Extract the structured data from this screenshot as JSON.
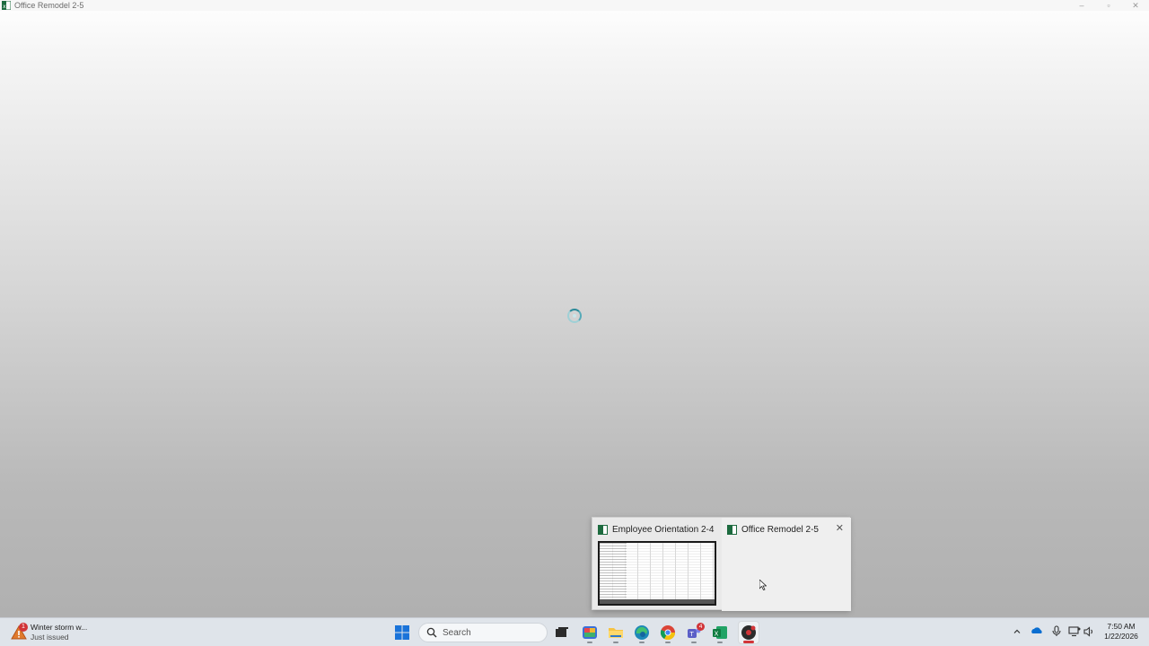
{
  "window": {
    "title": "Office Remodel 2-5",
    "icon": "excel-icon",
    "controls": {
      "minimize": "–",
      "maximize": "▫",
      "close": "✕"
    }
  },
  "loading": {
    "icon": "loading-spinner-icon"
  },
  "taskbar_preview": {
    "items": [
      {
        "title": "Employee Orientation 2-4",
        "icon": "excel-icon",
        "has_thumbnail": true
      },
      {
        "title": "Office Remodel 2-5",
        "icon": "excel-icon",
        "has_thumbnail": false,
        "close": "✕"
      }
    ]
  },
  "taskbar": {
    "weather": {
      "title": "Winter storm w...",
      "subtitle": "Just issued",
      "badge": "1",
      "icon": "weather-alert-icon"
    },
    "search_placeholder": "Search",
    "apps": [
      {
        "name": "start",
        "icon": "windows-start-icon"
      },
      {
        "name": "task-view",
        "icon": "task-view-icon"
      },
      {
        "name": "copilot",
        "icon": "copilot-icon"
      },
      {
        "name": "file-explorer",
        "icon": "folder-icon"
      },
      {
        "name": "edge",
        "icon": "edge-icon"
      },
      {
        "name": "chrome",
        "icon": "chrome-icon"
      },
      {
        "name": "teams",
        "icon": "teams-icon",
        "badge": "4"
      },
      {
        "name": "excel",
        "icon": "excel-icon"
      },
      {
        "name": "recorder",
        "icon": "recorder-icon",
        "active": true
      }
    ],
    "tray": {
      "icons": [
        "chevron-up-icon",
        "onedrive-icon",
        "microphone-icon",
        "network-icon",
        "volume-icon"
      ]
    },
    "clock": {
      "time": "7:50 AM",
      "date": "1/22/2026"
    }
  }
}
